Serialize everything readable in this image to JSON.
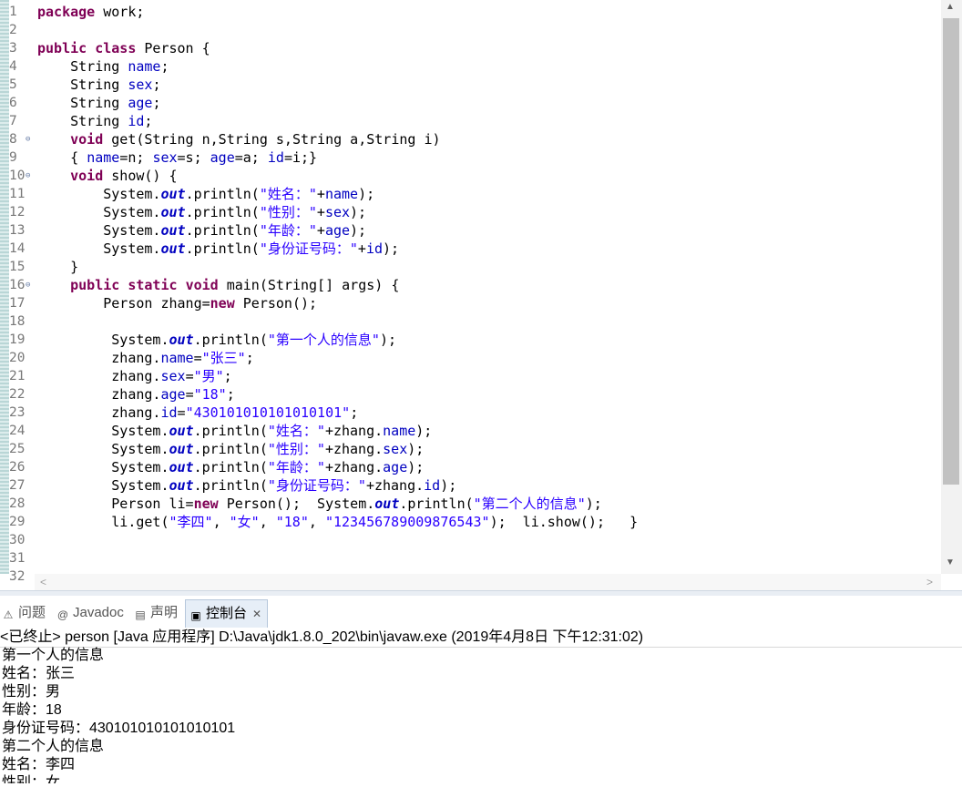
{
  "editor": {
    "lines": [
      {
        "n": "1",
        "html": "<span class=\"k\">package</span> work;"
      },
      {
        "n": "2",
        "html": ""
      },
      {
        "n": "3",
        "html": "<span class=\"k\">public</span> <span class=\"k\">class</span> Person {"
      },
      {
        "n": "4",
        "html": "    String <span class=\"f\">name</span>;"
      },
      {
        "n": "5",
        "html": "    String <span class=\"f\">sex</span>;"
      },
      {
        "n": "6",
        "html": "    String <span class=\"f\">age</span>;"
      },
      {
        "n": "7",
        "html": "    String <span class=\"f\">id</span>;"
      },
      {
        "n": "8",
        "fold": true,
        "html": "    <span class=\"k\">void</span> get(String n,String s,String a,String i)"
      },
      {
        "n": "9",
        "html": "    { <span class=\"f\">name</span>=n; <span class=\"f\">sex</span>=s; <span class=\"f\">age</span>=a; <span class=\"f\">id</span>=i;}"
      },
      {
        "n": "10",
        "fold": true,
        "html": "    <span class=\"k\">void</span> show() {"
      },
      {
        "n": "11",
        "html": "        System.<span class=\"st\">out</span>.println(<span class=\"s\">\"姓名：\"</span>+<span class=\"f\">name</span>);"
      },
      {
        "n": "12",
        "html": "        System.<span class=\"st\">out</span>.println(<span class=\"s\">\"性别：\"</span>+<span class=\"f\">sex</span>);"
      },
      {
        "n": "13",
        "html": "        System.<span class=\"st\">out</span>.println(<span class=\"s\">\"年龄：\"</span>+<span class=\"f\">age</span>);"
      },
      {
        "n": "14",
        "html": "        System.<span class=\"st\">out</span>.println(<span class=\"s\">\"身份证号码：\"</span>+<span class=\"f\">id</span>);"
      },
      {
        "n": "15",
        "html": "    }"
      },
      {
        "n": "16",
        "fold": true,
        "html": "    <span class=\"k\">public</span> <span class=\"k\">static</span> <span class=\"k\">void</span> main(String[] args) {"
      },
      {
        "n": "17",
        "html": "        Person zhang=<span class=\"k\">new</span> Person();"
      },
      {
        "n": "18",
        "html": ""
      },
      {
        "n": "19",
        "html": "         System.<span class=\"st\">out</span>.println(<span class=\"s\">\"第一个人的信息\"</span>);"
      },
      {
        "n": "20",
        "html": "         zhang.<span class=\"f\">name</span>=<span class=\"s\">\"张三\"</span>;"
      },
      {
        "n": "21",
        "html": "         zhang.<span class=\"f\">sex</span>=<span class=\"s\">\"男\"</span>;"
      },
      {
        "n": "22",
        "html": "         zhang.<span class=\"f\">age</span>=<span class=\"s\">\"18\"</span>;"
      },
      {
        "n": "23",
        "html": "         zhang.<span class=\"f\">id</span>=<span class=\"s\">\"430101010101010101\"</span>;"
      },
      {
        "n": "24",
        "html": "         System.<span class=\"st\">out</span>.println(<span class=\"s\">\"姓名：\"</span>+zhang.<span class=\"f\">name</span>);"
      },
      {
        "n": "25",
        "html": "         System.<span class=\"st\">out</span>.println(<span class=\"s\">\"性别：\"</span>+zhang.<span class=\"f\">sex</span>);"
      },
      {
        "n": "26",
        "html": "         System.<span class=\"st\">out</span>.println(<span class=\"s\">\"年龄：\"</span>+zhang.<span class=\"f\">age</span>);"
      },
      {
        "n": "27",
        "html": "         System.<span class=\"st\">out</span>.println(<span class=\"s\">\"身份证号码：\"</span>+zhang.<span class=\"f\">id</span>);"
      },
      {
        "n": "28",
        "html": "         Person li=<span class=\"k\">new</span> Person();  System.<span class=\"st\">out</span>.println(<span class=\"s\">\"第二个人的信息\"</span>);"
      },
      {
        "n": "29",
        "html": "         li.get(<span class=\"s\">\"李四\"</span>, <span class=\"s\">\"女\"</span>, <span class=\"s\">\"18\"</span>, <span class=\"s\">\"123456789009876543\"</span>);  li.show();   }"
      },
      {
        "n": "30",
        "html": ""
      },
      {
        "n": "31",
        "html": ""
      },
      {
        "n": "32",
        "html": ""
      }
    ]
  },
  "tabs": [
    {
      "icon": "problems-icon",
      "glyph": "⚠",
      "label": "问题",
      "active": false
    },
    {
      "icon": "javadoc-icon",
      "glyph": "@",
      "label": "Javadoc",
      "active": false
    },
    {
      "icon": "declaration-icon",
      "glyph": "▤",
      "label": "声明",
      "active": false
    },
    {
      "icon": "console-icon",
      "glyph": "▣",
      "label": "控制台",
      "active": true
    }
  ],
  "console": {
    "header": "<已终止> person [Java 应用程序] D:\\Java\\jdk1.8.0_202\\bin\\javaw.exe  (2019年4月8日 下午12:31:02)",
    "lines": [
      "第一个人的信息",
      "姓名：张三",
      "性别：男",
      "年龄：18",
      "身份证号码：430101010101010101",
      "第二个人的信息",
      "姓名：李四",
      "性别：女"
    ]
  }
}
